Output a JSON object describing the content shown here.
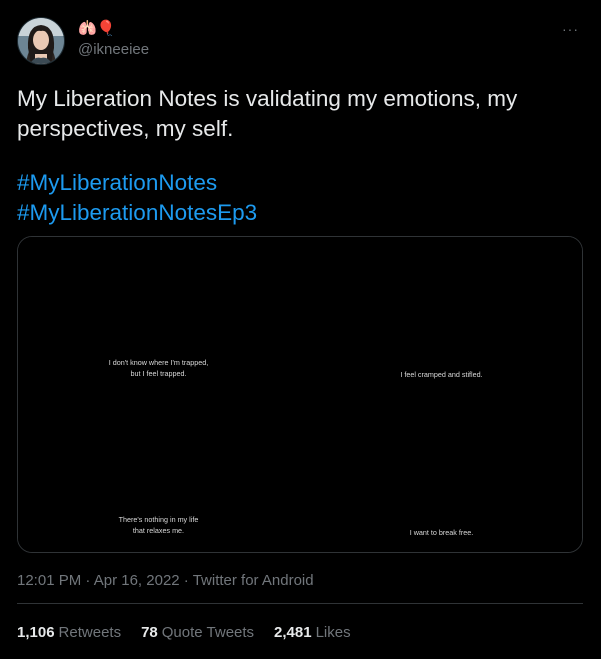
{
  "user": {
    "display_name": "🫁🎈",
    "handle": "@ikneeiee",
    "avatar": "avatar-photo"
  },
  "menu": {
    "more_label": "···"
  },
  "tweet": {
    "text": "My Liberation Notes is validating my emotions, my\nperspectives, my self.",
    "hashtags": [
      "#MyLiberationNotes",
      "#MyLiberationNotesEp3"
    ]
  },
  "media": {
    "left": {
      "top_caption": "I don't know where I'm trapped,\nbut I feel trapped.",
      "bottom_caption": "There's nothing in my life\nthat relaxes me."
    },
    "right": {
      "top_caption": "I feel cramped and stifled.",
      "bottom_caption": "I want to break free."
    }
  },
  "meta": {
    "time": "12:01 PM",
    "dot1": " · ",
    "date": "Apr 16, 2022",
    "dot2": " · ",
    "source": "Twitter for Android"
  },
  "stats": {
    "retweets": {
      "count": "1,106",
      "label": "Retweets"
    },
    "quotes": {
      "count": "78",
      "label": "Quote Tweets"
    },
    "likes": {
      "count": "2,481",
      "label": "Likes"
    }
  },
  "colors": {
    "background": "#000000",
    "text": "#e7e9ea",
    "secondary": "#71767b",
    "link": "#1d9bf0",
    "border": "#2f3336"
  }
}
